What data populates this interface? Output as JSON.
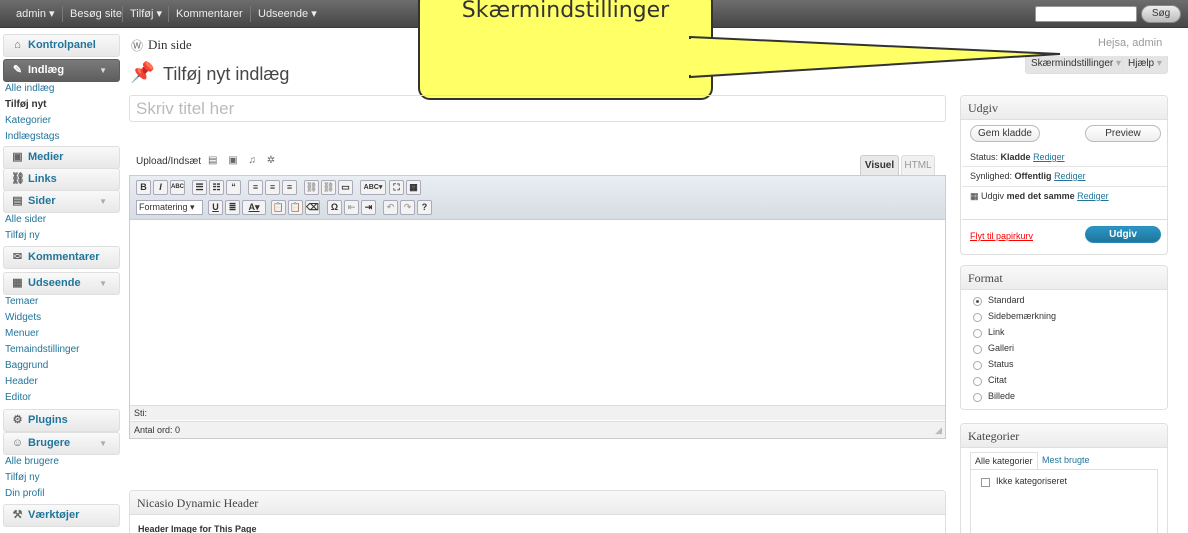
{
  "admin_bar": {
    "items": [
      "admin ▾",
      "Besøg site",
      "Tilføj ▾",
      "Kommentarer",
      "Udseende ▾"
    ],
    "search_button": "Søg"
  },
  "sidebar": {
    "menu": [
      {
        "label": "Kontrolpanel",
        "icon": "⌂"
      },
      {
        "label": "Indlæg",
        "icon": "✎",
        "current": true,
        "arrow": "▼"
      },
      {
        "label": "Medier",
        "icon": "▣"
      },
      {
        "label": "Links",
        "icon": "⛓"
      },
      {
        "label": "Sider",
        "icon": "▤",
        "arrow": "▼"
      },
      {
        "label": "Kommentarer",
        "icon": "✉"
      },
      {
        "label": "Udseende",
        "icon": "▦",
        "arrow": "▼"
      },
      {
        "label": "Plugins",
        "icon": "⚙"
      },
      {
        "label": "Brugere",
        "icon": "☺",
        "arrow": "▼"
      },
      {
        "label": "Værktøjer",
        "icon": "⚒"
      }
    ],
    "sub_posts": [
      "Alle indlæg",
      "Tilføj nyt",
      "Kategorier",
      "Indlægstags"
    ],
    "sub_pages": [
      "Alle sider",
      "Tilføj ny"
    ],
    "sub_appearance": [
      "Temaer",
      "Widgets",
      "Menuer",
      "Temaindstillinger",
      "Baggrund",
      "Header",
      "Editor"
    ],
    "sub_users": [
      "Alle brugere",
      "Tilføj ny",
      "Din profil"
    ]
  },
  "header": {
    "site": "Din side",
    "howdy": "Hejsa, admin",
    "screen_options": "Skærmindstillinger",
    "help": "Hjælp",
    "page_title": "Tilføj nyt indlæg"
  },
  "callout": "Skærmindstillinger",
  "editor": {
    "title_placeholder": "Skriv titel her",
    "upload_label": "Upload/Indsæt",
    "tab_visual": "Visuel",
    "tab_html": "HTML",
    "format_select": "Formatering",
    "path_label": "Sti:",
    "word_count": "Antal ord: 0"
  },
  "publish": {
    "title": "Udgiv",
    "save_draft": "Gem kladde",
    "preview": "Preview",
    "status_label": "Status:",
    "status_value": "Kladde",
    "visibility_label": "Synlighed:",
    "visibility_value": "Offentlig",
    "schedule_label": "Udgiv",
    "schedule_value": "med det samme",
    "edit_link": "Rediger",
    "trash": "Flyt til papirkurv",
    "publish_button": "Udgiv"
  },
  "format": {
    "title": "Format",
    "options": [
      "Standard",
      "Sidebemærkning",
      "Link",
      "Galleri",
      "Status",
      "Citat",
      "Billede"
    ],
    "selected": "Standard"
  },
  "categories": {
    "title": "Kategorier",
    "tab_all": "Alle kategorier",
    "tab_popular": "Mest brugte",
    "items": [
      "Ikke kategoriseret"
    ]
  },
  "plugin_box": {
    "title": "Nicasio Dynamic Header",
    "subtitle": "Header Image for This Page"
  },
  "colors": {
    "link": "#21759b",
    "publish": "#21759b",
    "callout": "#ffff66"
  }
}
